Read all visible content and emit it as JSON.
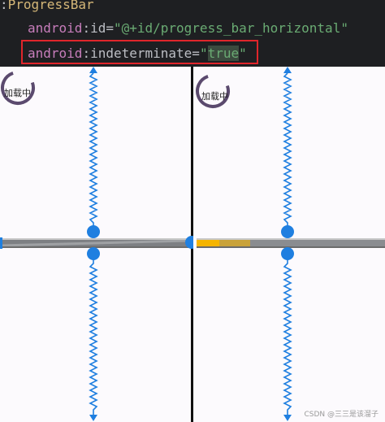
{
  "code": {
    "line1_prefix": ":",
    "tag": "ProgressBar",
    "line2": {
      "ns": "android",
      "attr": ":id=",
      "value": "\"@+id/progress_bar_horizontal\""
    },
    "line3": {
      "ns": "android",
      "attr": ":indeterminate=",
      "value_open": "\"",
      "value": "true",
      "value_close": "\""
    }
  },
  "preview": {
    "left": {
      "spinner_label": "加载中"
    },
    "right": {
      "spinner_label": "加载中"
    }
  },
  "colors": {
    "code_bg": "#1e1f22",
    "handle": "#1f7fe0",
    "progress_primary": "#f5b400",
    "progress_secondary": "#c9a23a",
    "track": "#8a8c90",
    "spinner": "#5b4a6e",
    "highlight_box": "#e0252b"
  },
  "icons": [
    "spinner-icon",
    "resize-handle-icon",
    "constraint-spring-icon"
  ],
  "watermark": "CSDN @三三是该溜子"
}
